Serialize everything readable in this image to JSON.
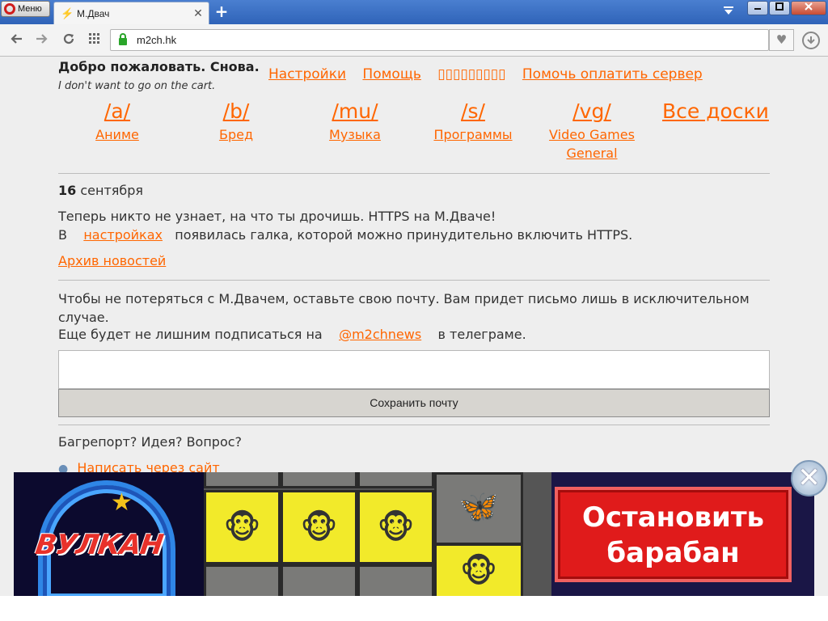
{
  "browser": {
    "menu_label": "Меню",
    "tab_title": "М.Двач",
    "tab_favicon": "⚡",
    "tab_close": "✕",
    "new_tab": "+",
    "url": "m2ch.hk"
  },
  "header": {
    "welcome": "Добро пожаловать. Снова.",
    "tagline": "I don't want to go on the cart.",
    "links": [
      "Настройки",
      "Помощь",
      "▯▯▯▯▯▯▯▯▯",
      "Помочь оплатить сервер"
    ]
  },
  "boards": [
    {
      "abbr": "/a/",
      "name": "Аниме"
    },
    {
      "abbr": "/b/",
      "name": "Бред"
    },
    {
      "abbr": "/mu/",
      "name": "Музыка"
    },
    {
      "abbr": "/s/",
      "name": "Программы"
    },
    {
      "abbr": "/vg/",
      "name": "Video Games General"
    }
  ],
  "all_boards": "Все доски",
  "news": {
    "day": "16",
    "month": "сентября",
    "line1": "Теперь никто не узнает, на что ты дрочишь. HTTPS на М.Дваче!",
    "line2_prefix": "В",
    "line2_link": "настройках",
    "line2_suffix": "появилась галка, которой можно принудительно включить HTTPS.",
    "archive": "Архив новостей"
  },
  "mail": {
    "text": "Чтобы не потеряться с М.Двачем, оставьте свою почту. Вам придет письмо лишь в исключительном случае.",
    "line3_prefix": "Еще будет не лишним подписаться на",
    "line3_link": "@m2chnews",
    "line3_suffix": "в телеграме.",
    "input_value": "",
    "save_label": "Сохранить почту"
  },
  "feedback": {
    "text": "Багрепорт? Идея? Вопрос?",
    "link": "Написать через сайт"
  },
  "ad": {
    "logo": "ВУЛКАН",
    "cta": "Остановить барабан",
    "close": "✕"
  },
  "colors": {
    "link": "#ff6600",
    "ad_cta": "#e01b1b"
  }
}
